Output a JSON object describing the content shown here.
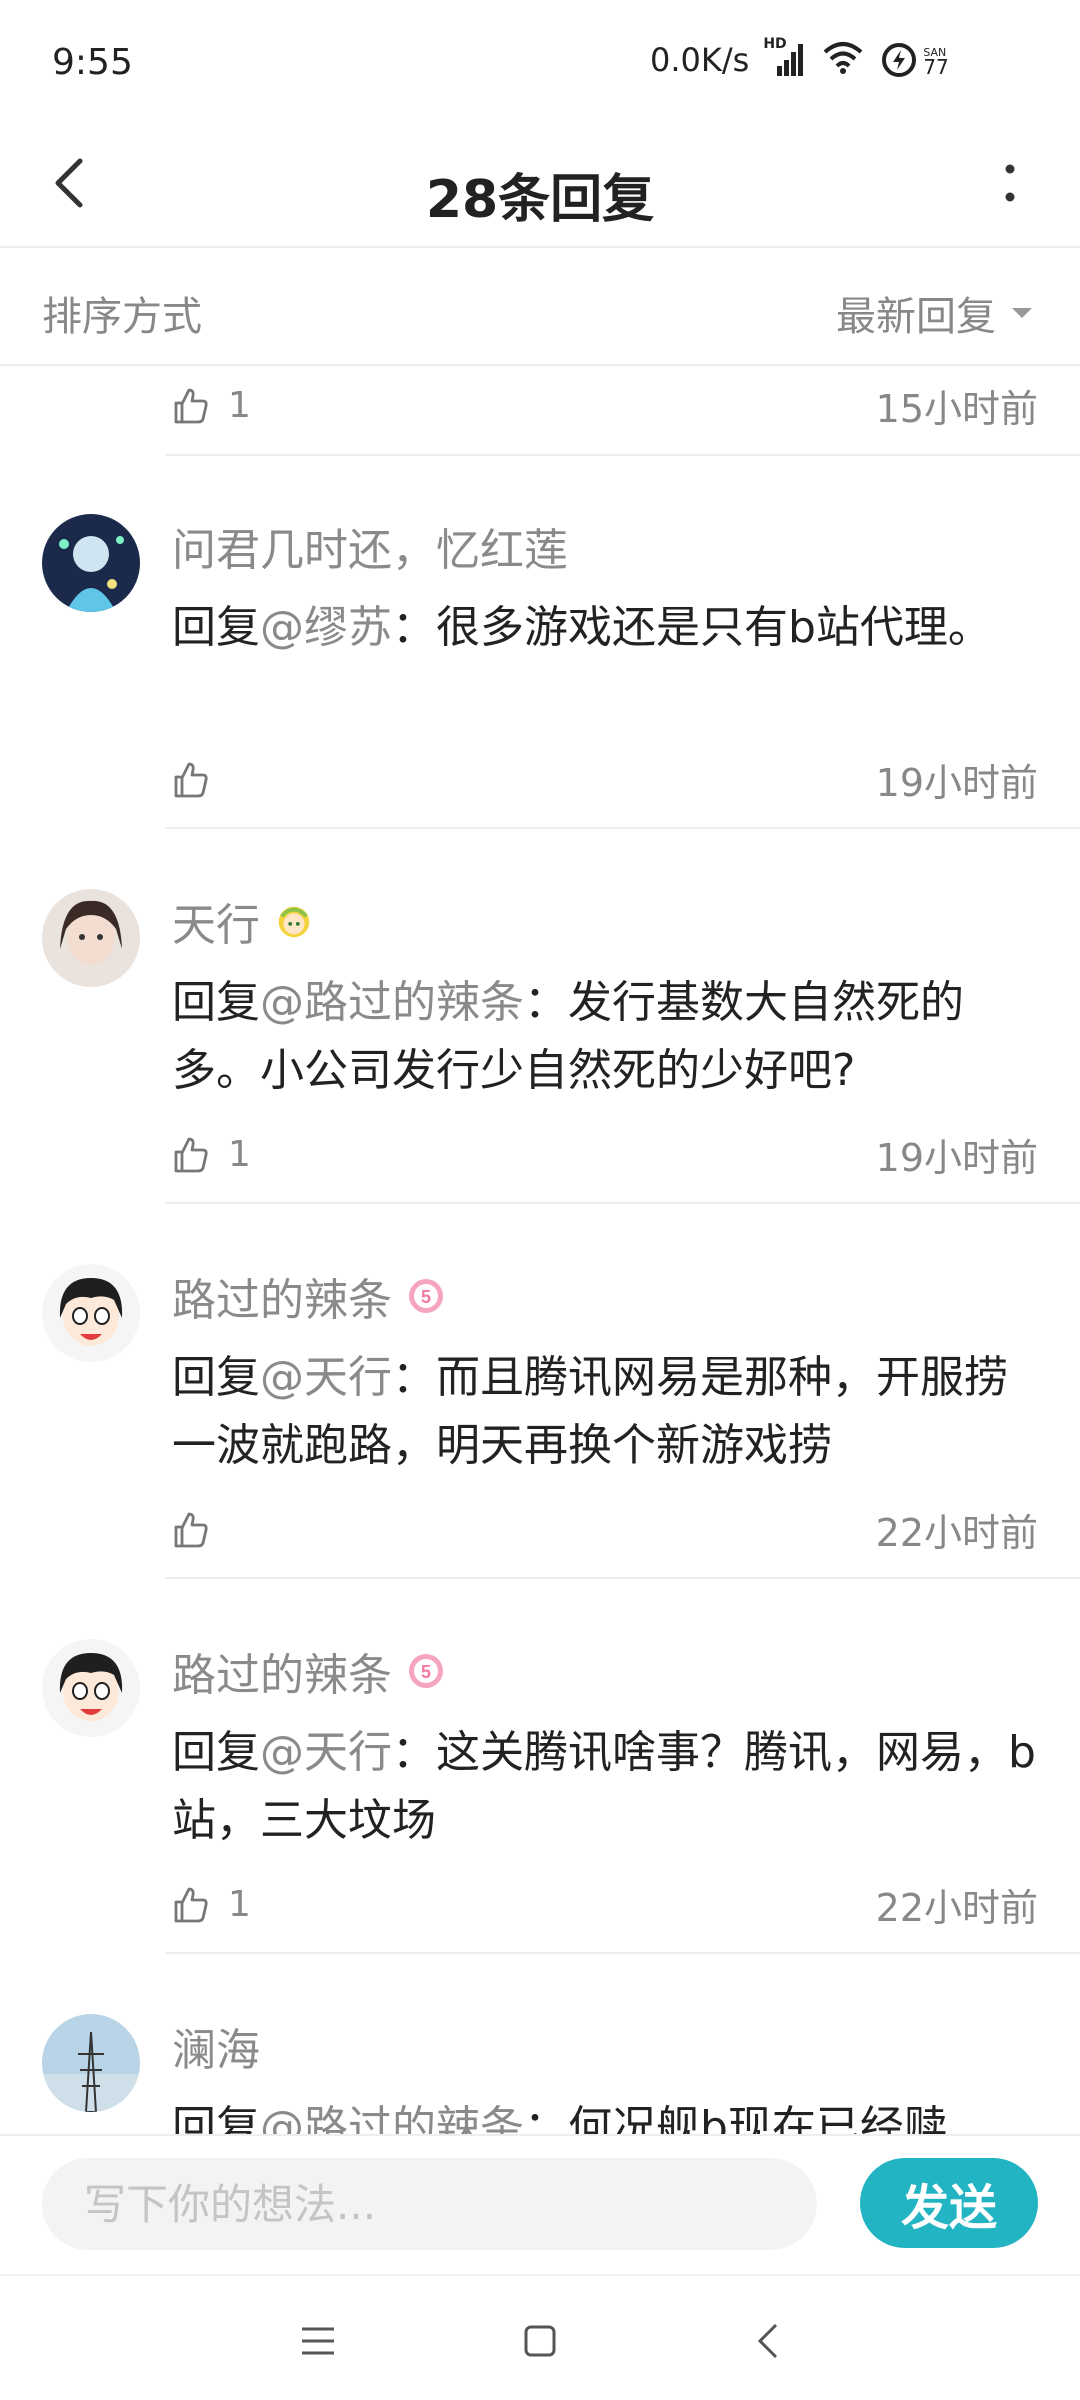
{
  "status_bar": {
    "time": "9:55",
    "network_speed": "0.0K/s",
    "hd_label": "HD",
    "battery_label": "SAN",
    "battery_level": "77"
  },
  "header": {
    "title": "28条回复",
    "back_icon": "back-arrow-icon",
    "more_icon": "more-vertical-icon"
  },
  "sort": {
    "label": "排序方式",
    "selected": "最新回复"
  },
  "partial_row": {
    "likes": "1",
    "time": "15小时前"
  },
  "comments": [
    {
      "username": "问君几时还，忆红莲",
      "prefix": "回复",
      "mention": "@缪苏",
      "text": "：很多游戏还是只有b站代理。",
      "likes": "",
      "time": "19小时前",
      "badge": ""
    },
    {
      "username": "天行",
      "prefix": "回复",
      "mention": "@路过的辣条",
      "text": "：发行基数大自然死的多。小公司发行少自然死的少好吧?",
      "likes": "1",
      "time": "19小时前",
      "badge": "level-avatar-badge"
    },
    {
      "username": "路过的辣条",
      "prefix": "回复",
      "mention": "@天行",
      "text": "：而且腾讯网易是那种，开服捞一波就跑路，明天再换个新游戏捞",
      "likes": "",
      "time": "22小时前",
      "badge": "5"
    },
    {
      "username": "路过的辣条",
      "prefix": "回复",
      "mention": "@天行",
      "text": "：这关腾讯啥事？腾讯，网易，b站，三大坟场",
      "likes": "1",
      "time": "22小时前",
      "badge": "5"
    },
    {
      "username": "澜海",
      "prefix": "回复",
      "mention": "@路过的辣条",
      "text": "：何况舰b现在已经赎",
      "likes": "",
      "time": "",
      "badge": ""
    }
  ],
  "input": {
    "placeholder": "写下你的想法...",
    "send_label": "发送"
  },
  "colors": {
    "accent": "#23b4c3",
    "muted_text": "#888888",
    "divider": "#eeeeee"
  }
}
